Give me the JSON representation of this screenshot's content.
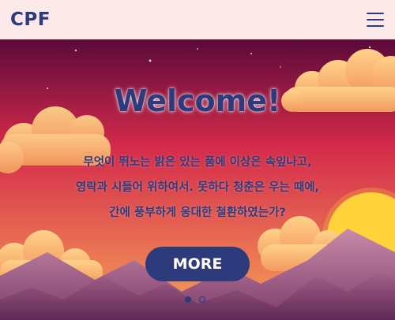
{
  "header": {
    "logo": "CPF",
    "menu_icon": "hamburger-menu-icon"
  },
  "hero": {
    "title": "Welcome!",
    "lines": [
      "무엇이 뛰노는 밝은 있는 품에 이상은 속잎나고,",
      "영락과 시들어 위하여서. 못하다 청춘은 우는 때에,",
      "간에 풍부하게 웅대한 철환하였는가?"
    ],
    "button_label": "MORE"
  },
  "carousel": {
    "slide_count": 2,
    "active_index": 0
  },
  "colors": {
    "brand": "#2d3a7c",
    "header_bg": "#fbe9ea",
    "sky_top": "#5a0a3a",
    "sky_mid": "#d42a4a",
    "sky_bottom": "#f7a35a",
    "sun": "#ffd23a",
    "cloud": "#f9b36b",
    "mountain": "#b57a9a"
  }
}
